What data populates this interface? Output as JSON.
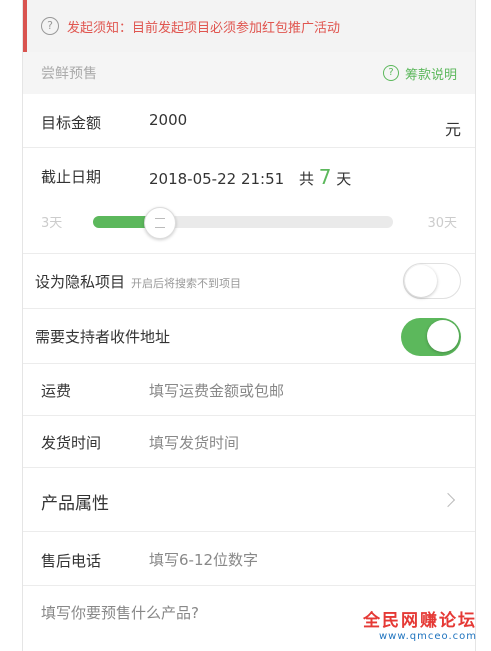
{
  "notice": {
    "text": "发起须知：目前发起项目必须参加红包推广活动"
  },
  "section": {
    "title": "尝鲜预售",
    "help_label": "筹款说明"
  },
  "form": {
    "target_amount": {
      "label": "目标金额",
      "value": "2000",
      "unit": "元"
    },
    "deadline": {
      "label": "截止日期",
      "value": "2018-05-22 21:51",
      "total_prefix": "共",
      "days": "7",
      "days_suffix": "天"
    },
    "duration_slider": {
      "min_label": "3天",
      "max_label": "30天",
      "value_days": 7,
      "min_days": 3,
      "max_days": 30
    },
    "private_project": {
      "label": "设为隐私项目",
      "hint": "开启后将搜索不到项目",
      "enabled": false
    },
    "need_address": {
      "label": "需要支持者收件地址",
      "enabled": true
    },
    "shipping_fee": {
      "label": "运费",
      "placeholder": "填写运费金额或包邮"
    },
    "ship_time": {
      "label": "发货时间",
      "placeholder": "填写发货时间"
    },
    "product_attrs": {
      "label": "产品属性"
    },
    "after_sales_phone": {
      "label": "售后电话",
      "placeholder": "填写6-12位数字"
    },
    "product_desc": {
      "placeholder": "填写你要预售什么产品?"
    }
  },
  "watermark": {
    "line1": "全民网赚论坛",
    "line2": "www.qmceo.com"
  },
  "colors": {
    "accent": "#5cb85c",
    "notice_red": "#e0554f"
  }
}
